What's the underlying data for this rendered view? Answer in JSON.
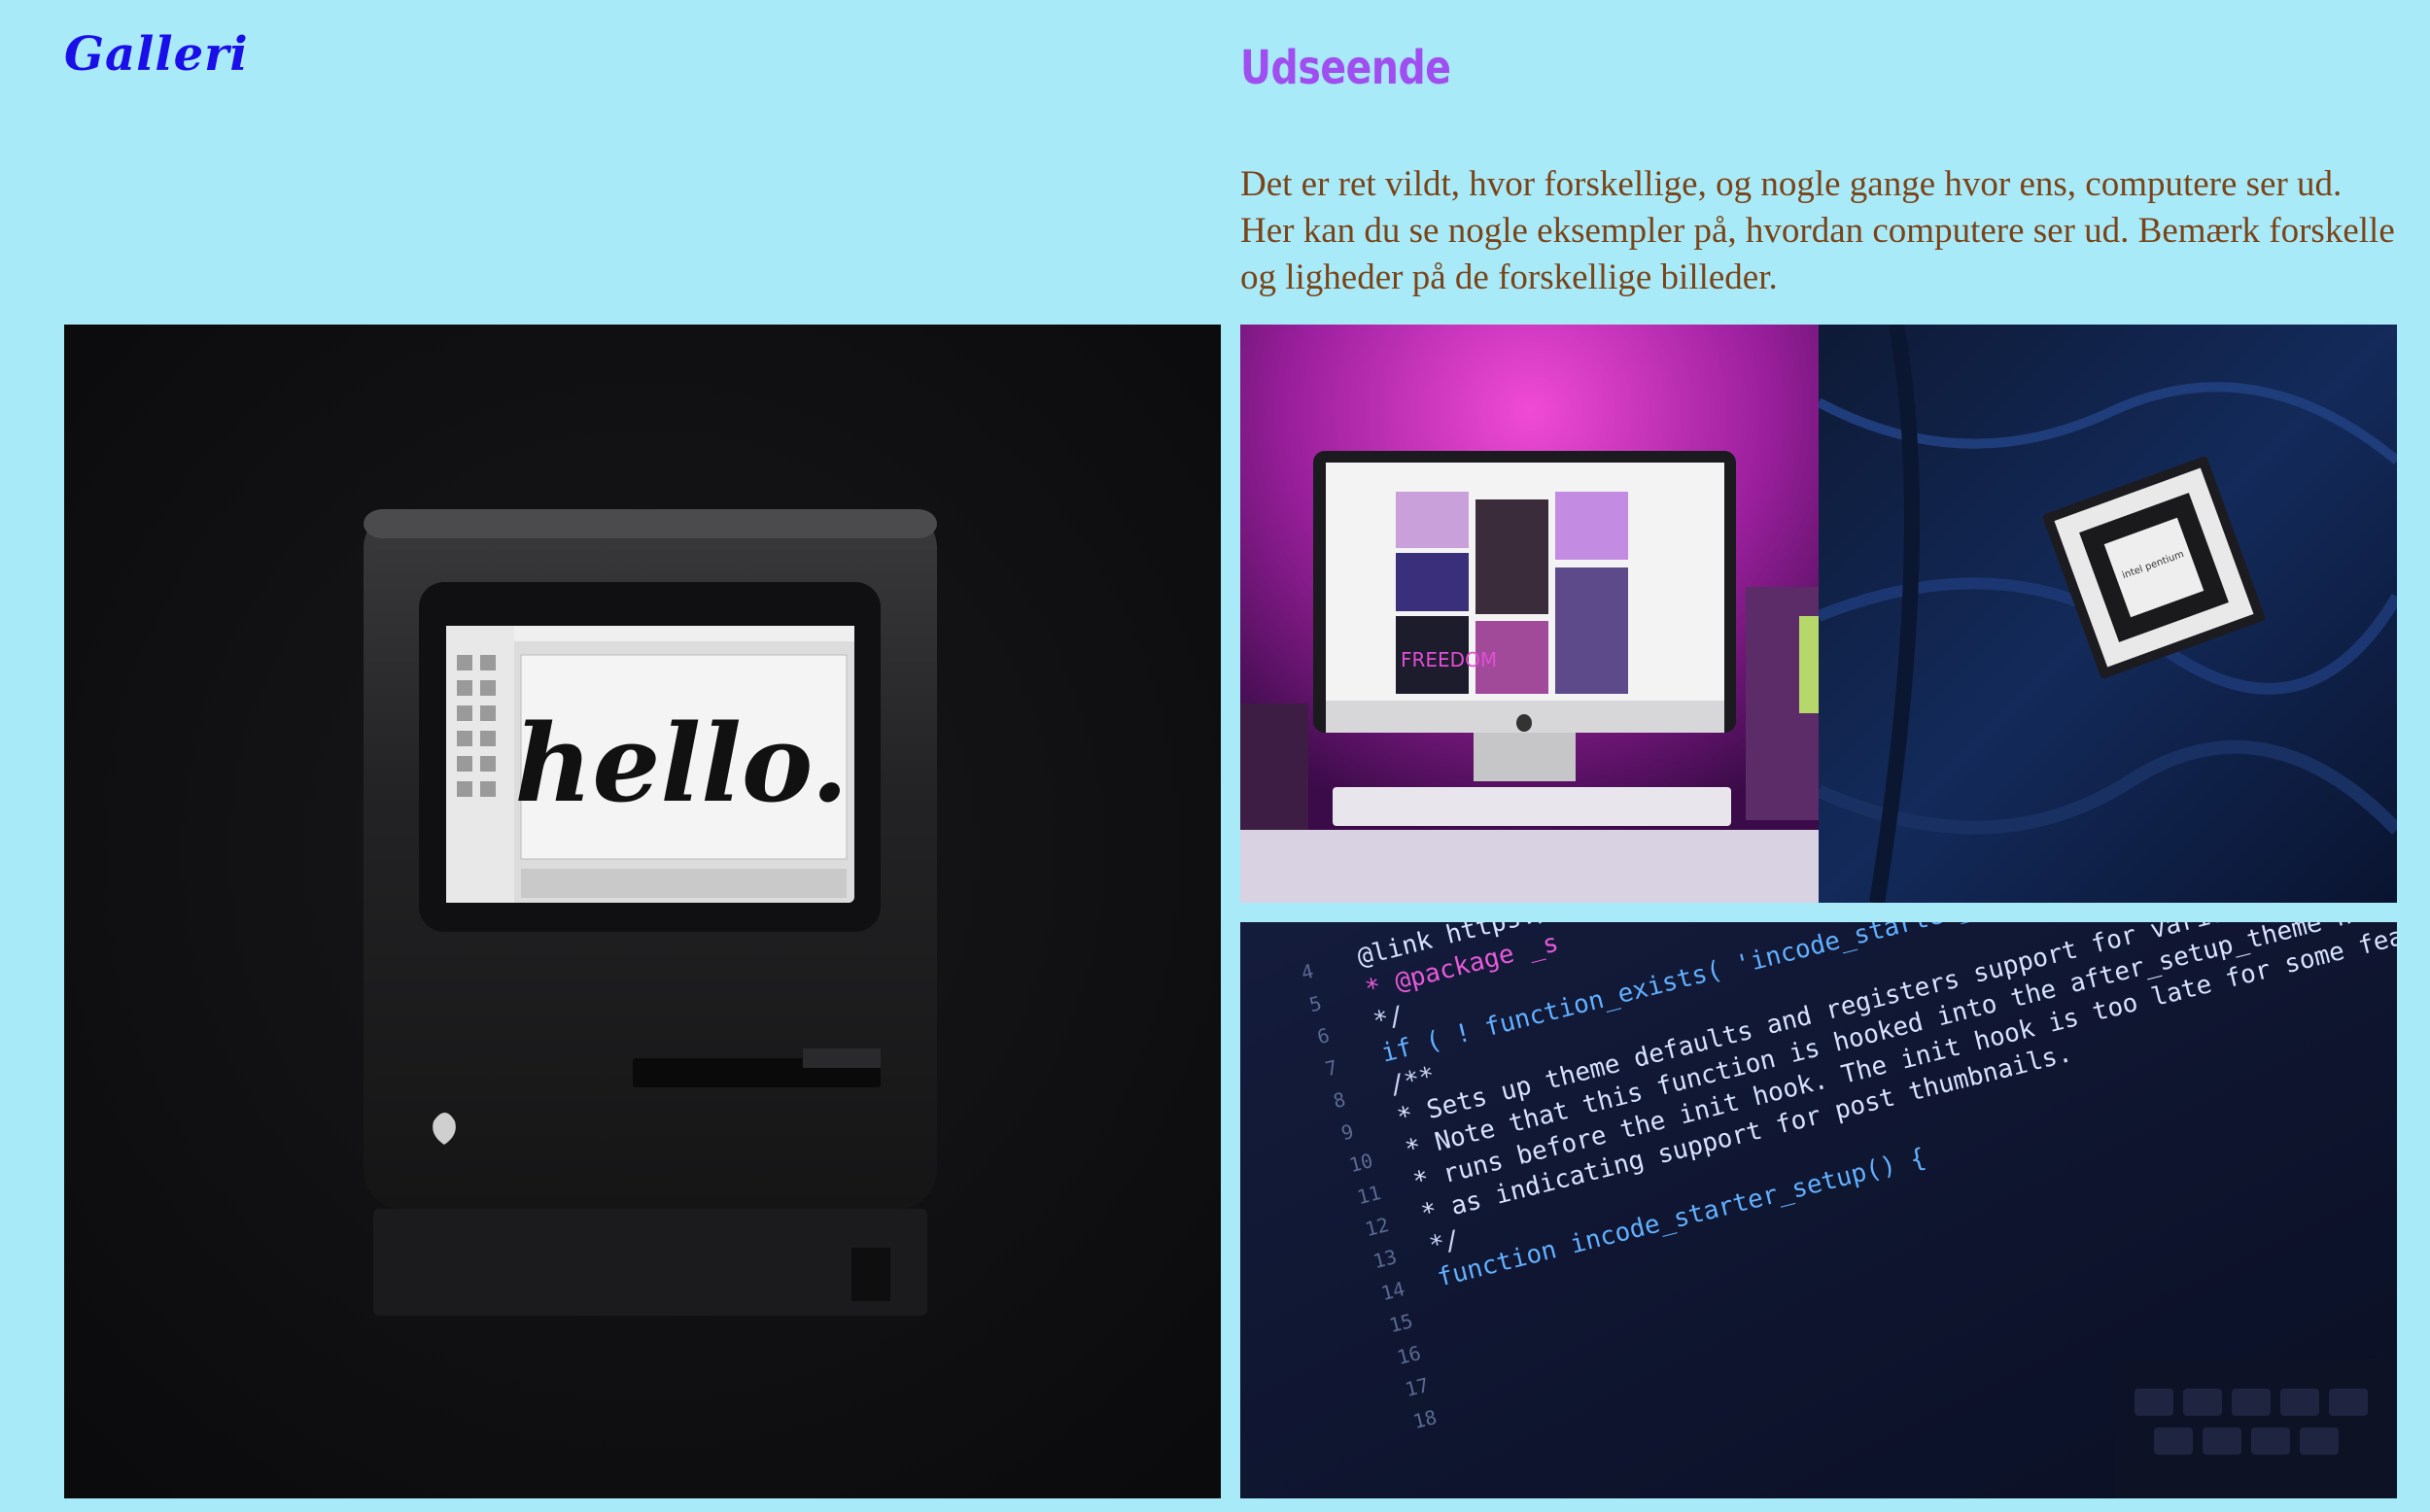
{
  "header": {
    "logo": "Galleri"
  },
  "section": {
    "heading": "Udseende",
    "intro": "Det er ret vildt, hvor forskellige, og nogle gange hvor ens, computere ser ud. Her kan du se nogle eksempler på, hvordan computere ser ud. Bemærk forskelle og ligheder på de forskellige billeder."
  },
  "gallery": {
    "mac": {
      "screen_text": "hello."
    },
    "imac": {
      "sign_text": "FREEDOM"
    },
    "cpu": {
      "chip_text": "intel pentium"
    },
    "code": {
      "lines": [
        "@link https://deve",
        "* @package _s",
        "*/",
        "if ( ! function_exists( 'incode_starter_setup' ) ) :",
        "/**",
        "* Sets up theme defaults and registers support for various WordPress fe",
        "* Note that this function is hooked into the after_setup_theme hook, which",
        "* runs before the init hook. The init hook is too late for some features, such",
        "* as indicating support for post thumbnails.",
        "*/",
        "function incode_starter_setup() {"
      ],
      "line_numbers": [
        "4",
        "5",
        "6",
        "7",
        "8",
        "9",
        "10",
        "11",
        "12",
        "13",
        "14",
        "15",
        "16",
        "17",
        "18"
      ]
    }
  },
  "colors": {
    "background": "#a9eaf9",
    "logo": "#1a0fe8",
    "heading": "#a04ef0",
    "body_text": "#7a4418"
  }
}
